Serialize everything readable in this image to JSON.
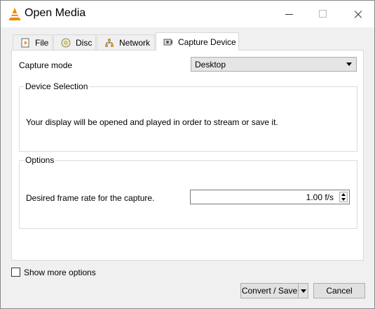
{
  "window": {
    "title": "Open Media",
    "accent": "#0078d7"
  },
  "tabs": [
    {
      "label": "File",
      "icon": "file-icon"
    },
    {
      "label": "Disc",
      "icon": "disc-icon"
    },
    {
      "label": "Network",
      "icon": "network-icon"
    },
    {
      "label": "Capture Device",
      "icon": "capture-device-icon",
      "active": true
    }
  ],
  "capture": {
    "mode_label": "Capture mode",
    "mode_value": "Desktop"
  },
  "device_selection": {
    "title": "Device Selection",
    "message": "Your display will be opened and played in order to stream or save it."
  },
  "options": {
    "title": "Options",
    "frame_rate_label": "Desired frame rate for the capture.",
    "frame_rate_value": "1.00 f/s"
  },
  "footer": {
    "show_more": "Show more options",
    "show_more_checked": false,
    "convert_save": "Convert / Save",
    "cancel": "Cancel"
  }
}
